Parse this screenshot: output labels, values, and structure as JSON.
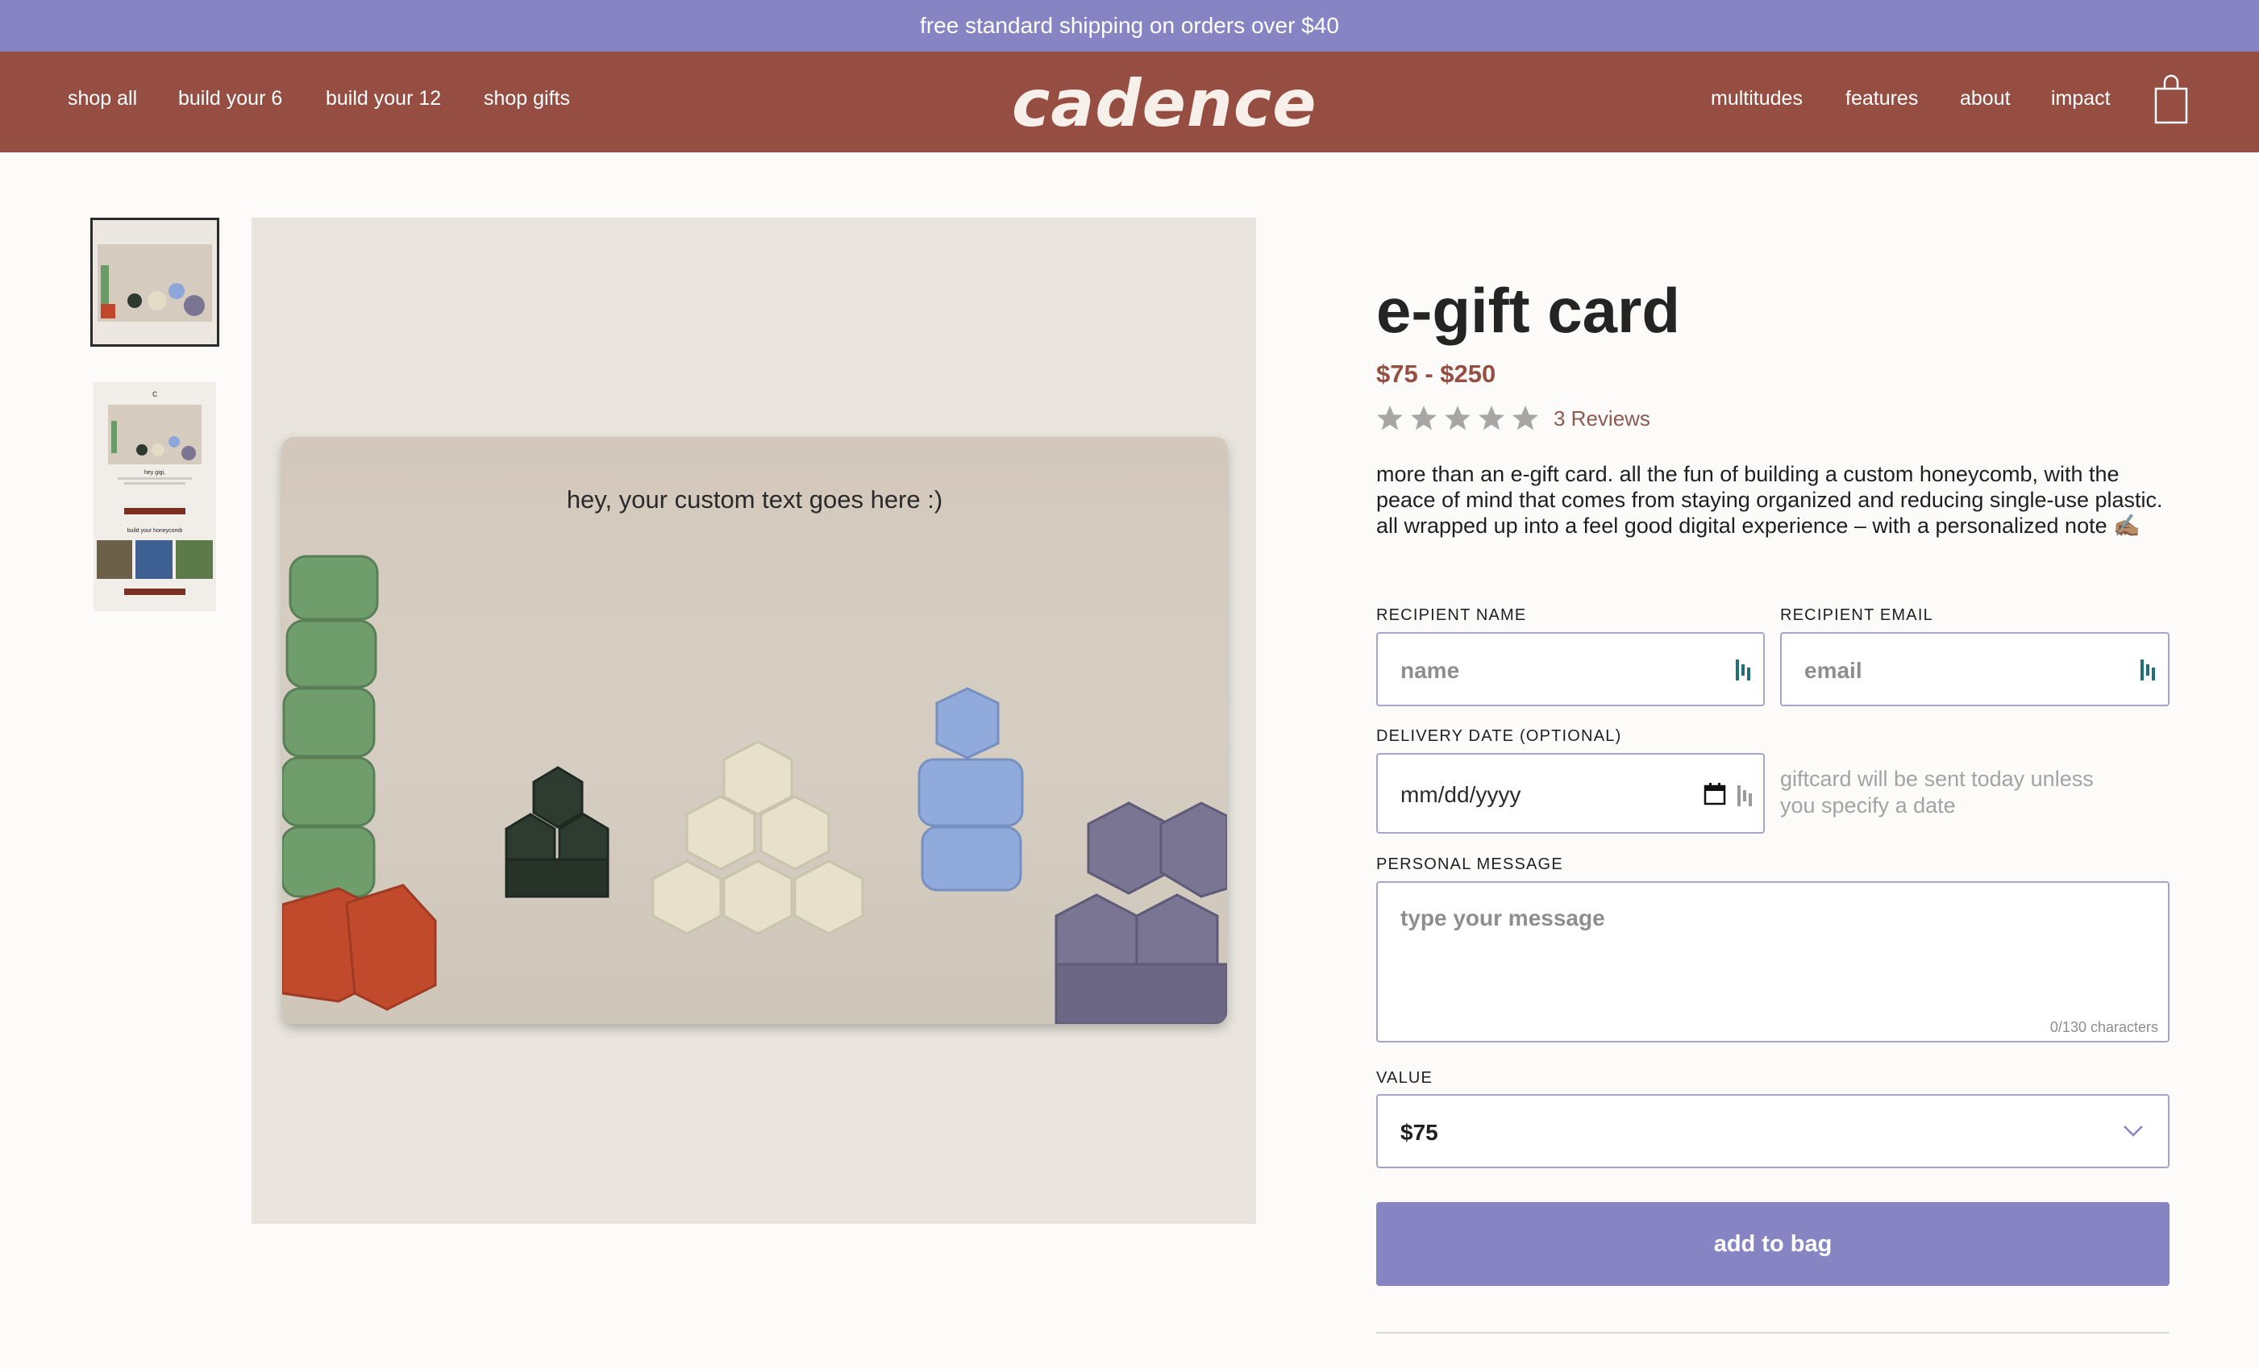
{
  "promo": {
    "text": "free standard shipping on orders over $40"
  },
  "header": {
    "logo": "cadence",
    "nav_left": [
      "shop all",
      "build your 6",
      "build your 12",
      "shop gifts"
    ],
    "nav_right": [
      "multitudes",
      "features",
      "about",
      "impact"
    ],
    "bag_icon": "shopping-bag-icon",
    "background": "#954e41"
  },
  "gallery": {
    "card_text": "hey, your custom text goes here :)",
    "thumb2_texts": {
      "logo": "c",
      "greeting": "hey gigi,",
      "heading": "build your honeycomb"
    }
  },
  "product": {
    "title": "e-gift card",
    "price": "$75 - $250",
    "rating": 5,
    "reviews": "3 Reviews",
    "description": "more than an e-gift card. all the fun of building a custom honeycomb, with the peace of mind that comes from staying organized and reducing single-use plastic. all wrapped up into a feel good digital experience – with a personalized note ✍🏽"
  },
  "form": {
    "recipient_name": {
      "label": "RECIPIENT NAME",
      "placeholder": "name"
    },
    "recipient_email": {
      "label": "RECIPIENT EMAIL",
      "placeholder": "email"
    },
    "delivery_date": {
      "label": "DELIVERY DATE (OPTIONAL)",
      "placeholder": "mm/dd/yyyy",
      "hint": "giftcard will be sent today unless you specify a date"
    },
    "message": {
      "label": "PERSONAL MESSAGE",
      "placeholder": "type your message",
      "counter": "0/130 characters"
    },
    "value": {
      "label": "VALUE",
      "selected": "$75"
    },
    "add_button": "add to bag"
  },
  "colors": {
    "accent": "#8684c2",
    "brand": "#954e41",
    "price": "#954e41"
  }
}
